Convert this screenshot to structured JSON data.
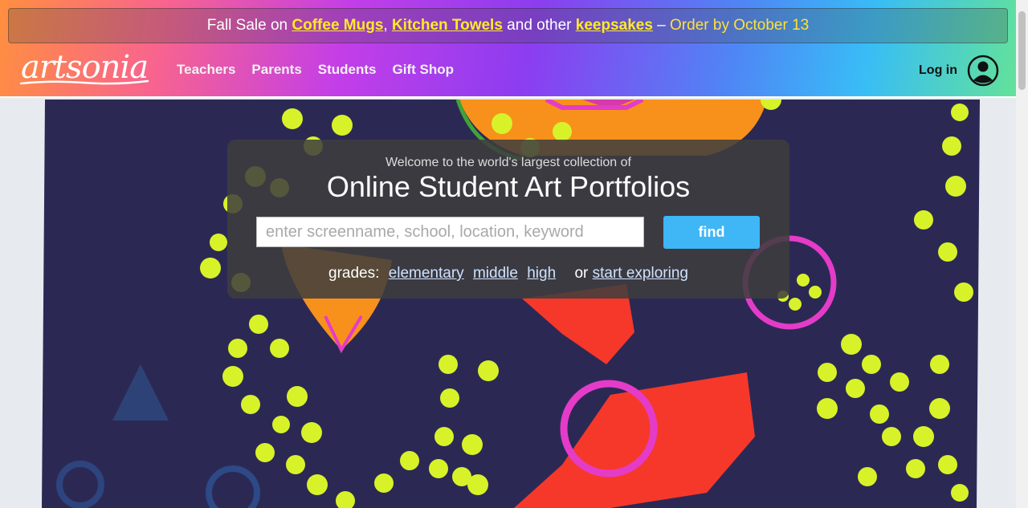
{
  "promo": {
    "prefix": "Fall Sale on ",
    "link1": "Coffee Mugs",
    "comma": ",",
    "link2": "Kitchen Towels",
    "middle": " and other ",
    "link3": "keepsakes",
    "dash": " – ",
    "deadline": "Order by October 13"
  },
  "logo": {
    "text": "artsonia"
  },
  "nav": {
    "items": [
      "Teachers",
      "Parents",
      "Students",
      "Gift Shop"
    ]
  },
  "login": {
    "label": "Log in",
    "icon": "user-circle-icon"
  },
  "hero": {
    "welcome": "Welcome to the world's largest collection of",
    "headline": "Online Student Art Portfolios",
    "search_placeholder": "enter screenname, school, location, keyword",
    "search_value": "",
    "find_label": "find",
    "grades_label": "grades:",
    "grade_links": [
      "elementary",
      "middle",
      "high"
    ],
    "or_text": "or",
    "explore_link": "start exploring"
  },
  "colors": {
    "promo_link": "#ffea2a",
    "find_button": "#3fb6f5",
    "artwork_background": "#2b2954",
    "dots": "#d8f22a"
  }
}
